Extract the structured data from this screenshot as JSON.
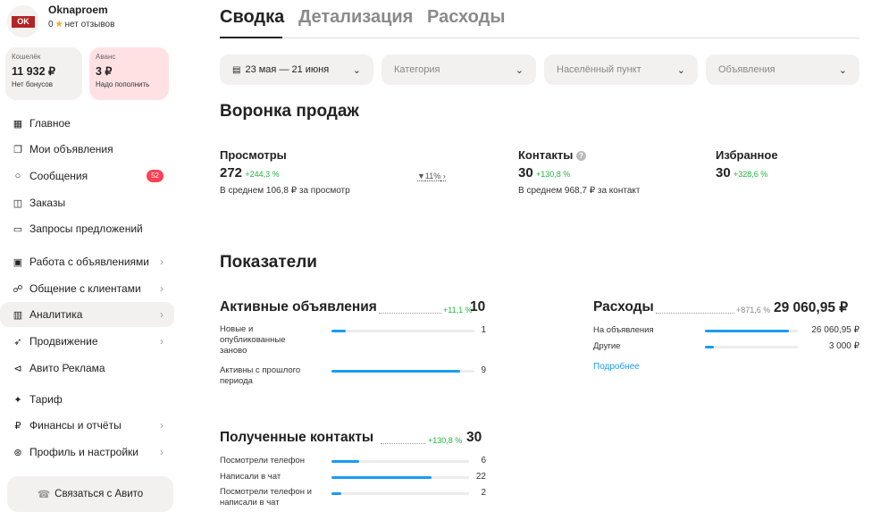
{
  "profile": {
    "name": "Oknaproem",
    "rating": "0",
    "reviews": "нет отзывов"
  },
  "wallet": {
    "label": "Кошелёк",
    "value": "11 932 ₽",
    "sub": "Нет бонусов"
  },
  "advance": {
    "label": "Аванс",
    "value": "3 ₽",
    "sub": "Надо пополнить"
  },
  "colors": {
    "accent": "#1a9cf0",
    "green": "#1eb63c",
    "badge": "#ff4053",
    "advance_bg": "#ffe1e4"
  },
  "nav": [
    {
      "icon": "grid-icon",
      "label": "Главное"
    },
    {
      "icon": "ads-icon",
      "label": "Мои объявления"
    },
    {
      "icon": "chat-icon",
      "label": "Сообщения",
      "badge": "52"
    },
    {
      "icon": "box-icon",
      "label": "Заказы"
    },
    {
      "icon": "folder-icon",
      "label": "Запросы предложений"
    },
    {
      "icon": "work-icon",
      "label": "Работа с объявлениями"
    },
    {
      "icon": "people-icon",
      "label": "Общение с клиентами"
    },
    {
      "icon": "analytics-icon",
      "label": "Аналитика"
    },
    {
      "icon": "rocket-icon",
      "label": "Продвижение"
    },
    {
      "icon": "megaphone-icon",
      "label": "Авито Реклама"
    },
    {
      "icon": "tariff-icon",
      "label": "Тариф"
    },
    {
      "icon": "ruble-icon",
      "label": "Финансы и отчёты"
    },
    {
      "icon": "settings-icon",
      "label": "Профиль и настройки"
    }
  ],
  "contact_button": "Связаться с Авито",
  "tabs": [
    "Сводка",
    "Детализация",
    "Расходы"
  ],
  "filters": {
    "date": "23 мая — 21 июня",
    "category": "Категория",
    "city": "Населённый пункт",
    "ads": "Объявления"
  },
  "funnel": {
    "title": "Воронка продаж",
    "views": {
      "title": "Просмотры",
      "value": "272",
      "delta": "+244,3 %",
      "sub": "В среднем 106,8 ₽ за просмотр"
    },
    "conversion": "11%",
    "contacts": {
      "title": "Контакты",
      "value": "30",
      "delta": "+130,8 %",
      "sub": "В среднем 968,7 ₽ за контакт"
    },
    "favorites": {
      "title": "Избранное",
      "value": "30",
      "delta": "+328,6 %"
    }
  },
  "indicators": {
    "title": "Показатели",
    "active_ads": {
      "title": "Активные объявления",
      "delta": "+11,1 %",
      "value": "10",
      "rows": [
        {
          "label": "Новые и опубликованные заново",
          "value": "1",
          "fill": 0.1
        },
        {
          "label": "Активны с прошлого периода",
          "value": "9",
          "fill": 0.9
        }
      ]
    },
    "expenses": {
      "title": "Расходы",
      "delta": "+871,6 %",
      "value": "29 060,95 ₽",
      "rows": [
        {
          "label": "На объявления",
          "value": "26 060,95 ₽",
          "fill": 0.9
        },
        {
          "label": "Другие",
          "value": "3 000 ₽",
          "fill": 0.1
        }
      ],
      "more": "Подробнее"
    },
    "contacts": {
      "title": "Полученные контакты",
      "delta": "+130,8 %",
      "value": "30",
      "rows": [
        {
          "label": "Посмотрели телефон",
          "value": "6",
          "fill": 0.2
        },
        {
          "label": "Написали в чат",
          "value": "22",
          "fill": 0.73
        },
        {
          "label": "Посмотрели телефон и написали в чат",
          "value": "2",
          "fill": 0.07
        }
      ]
    }
  }
}
